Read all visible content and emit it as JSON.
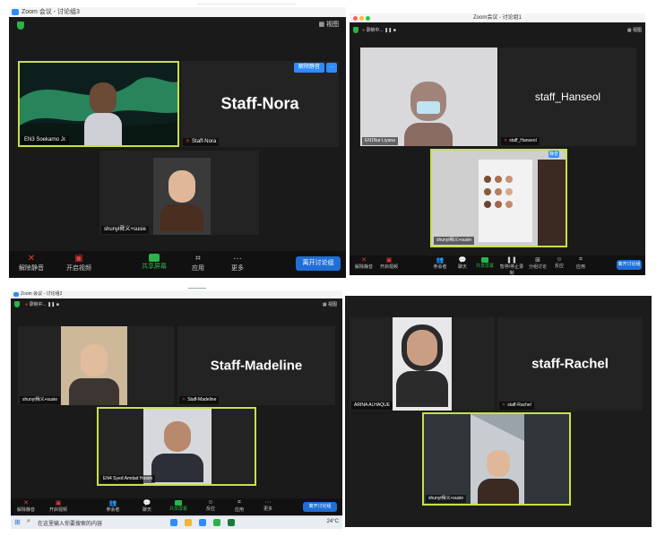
{
  "panel1": {
    "window_title": "Zoom 会议 - 讨论组3",
    "view_label": "视图",
    "unmute_button": "解除静音",
    "more_dots": "···",
    "big_name": "Staff-Nora",
    "tiles": [
      {
        "name": "EN3 Soekarno Jr."
      },
      {
        "name": "Staff-Nora"
      },
      {
        "name": "shunyi舜义+susie"
      }
    ],
    "toolbar": [
      {
        "label": "解除静音"
      },
      {
        "label": "开启视频"
      },
      {
        "label": "共享屏幕"
      },
      {
        "label": "应用"
      },
      {
        "label": "更多"
      }
    ],
    "leave_button": "离开讨论组"
  },
  "panel2": {
    "window_title": "Zoom会议 - 讨论组1",
    "recording": "录制中...",
    "view_label": "视图",
    "big_name": "staff_Hanseol",
    "badge": "静音",
    "tiles": [
      {
        "name": "EN1Nur Liyana"
      },
      {
        "name": "staff_Hanseol"
      },
      {
        "name": "shunyi舜义+susie"
      }
    ],
    "toolbar": [
      {
        "label": "解除静音"
      },
      {
        "label": "开启视频"
      },
      {
        "label": "参会者"
      },
      {
        "label": "聊天"
      },
      {
        "label": "共享屏幕"
      },
      {
        "label": "暂停/停止录制"
      },
      {
        "label": "分组讨论"
      },
      {
        "label": "反应"
      },
      {
        "label": "应用"
      }
    ],
    "leave_button": "离开讨论组"
  },
  "panel3": {
    "window_title": "Zoom 会议 - 讨论组2",
    "recording": "录制中...",
    "view_label": "视图",
    "big_name": "Staff-Madeline",
    "tiles": [
      {
        "name": "shunyi舜义+susie"
      },
      {
        "name": "Staff-Madeline"
      },
      {
        "name": "EN4 Syed Amdad Hosen"
      }
    ],
    "toolbar": [
      {
        "label": "解除静音"
      },
      {
        "label": "开启视频"
      },
      {
        "label": "参会者"
      },
      {
        "label": "聊天"
      },
      {
        "label": "共享屏幕"
      },
      {
        "label": "反应"
      },
      {
        "label": "应用"
      },
      {
        "label": "更多"
      }
    ],
    "leave_button": "离开讨论组",
    "taskbar": {
      "search_placeholder": "在这里输入你要搜索的内容",
      "weather": "24°C"
    }
  },
  "panel4": {
    "big_name": "staff-Rachel",
    "tiles": [
      {
        "name": "ARINA ALHAQUE"
      },
      {
        "name": "staff-Rachel"
      },
      {
        "name": "shunyi舜义+susie"
      }
    ]
  },
  "colors": {
    "zoom_blue": "#2d8cff",
    "active_border": "#c8e04a",
    "share_green": "#2bb34a",
    "muted_red": "#e23b3b",
    "tile_bg": "#232323"
  }
}
